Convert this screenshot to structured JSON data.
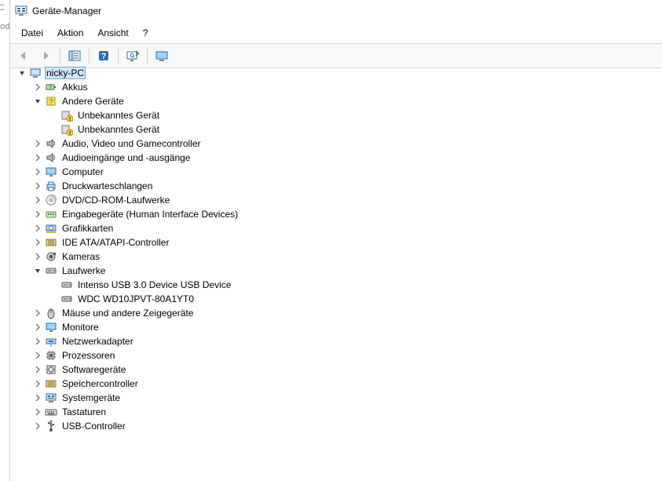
{
  "window": {
    "title": "Geräte-Manager"
  },
  "menubar": {
    "items": [
      "Datei",
      "Aktion",
      "Ansicht",
      "?"
    ]
  },
  "toolbar": {
    "back_enabled": false,
    "forward_enabled": false
  },
  "tree": {
    "root": {
      "label": "nicky-PC",
      "icon": "computer-icon",
      "expanded": true,
      "selected": true
    },
    "categories": [
      {
        "label": "Akkus",
        "icon": "battery-icon",
        "expandable": true,
        "expanded": false
      },
      {
        "label": "Andere Geräte",
        "icon": "other-devices-icon",
        "expandable": true,
        "expanded": true,
        "children": [
          {
            "label": "Unbekanntes Gerät",
            "icon": "unknown-device-icon"
          },
          {
            "label": "Unbekanntes Gerät",
            "icon": "unknown-device-icon"
          }
        ]
      },
      {
        "label": "Audio, Video und Gamecontroller",
        "icon": "audio-icon",
        "expandable": true,
        "expanded": false
      },
      {
        "label": "Audioeingänge und -ausgänge",
        "icon": "audio-io-icon",
        "expandable": true,
        "expanded": false
      },
      {
        "label": "Computer",
        "icon": "monitor-icon",
        "expandable": true,
        "expanded": false
      },
      {
        "label": "Druckwarteschlangen",
        "icon": "printer-icon",
        "expandable": true,
        "expanded": false
      },
      {
        "label": "DVD/CD-ROM-Laufwerke",
        "icon": "disc-icon",
        "expandable": true,
        "expanded": false
      },
      {
        "label": "Eingabegeräte (Human Interface Devices)",
        "icon": "hid-icon",
        "expandable": true,
        "expanded": false
      },
      {
        "label": "Grafikkarten",
        "icon": "gpu-icon",
        "expandable": true,
        "expanded": false
      },
      {
        "label": "IDE ATA/ATAPI-Controller",
        "icon": "ide-icon",
        "expandable": true,
        "expanded": false
      },
      {
        "label": "Kameras",
        "icon": "camera-icon",
        "expandable": true,
        "expanded": false
      },
      {
        "label": "Laufwerke",
        "icon": "drive-icon",
        "expandable": true,
        "expanded": true,
        "children": [
          {
            "label": "Intenso USB 3.0 Device USB Device",
            "icon": "drive-icon"
          },
          {
            "label": "WDC WD10JPVT-80A1YT0",
            "icon": "drive-icon"
          }
        ]
      },
      {
        "label": "Mäuse und andere Zeigegeräte",
        "icon": "mouse-icon",
        "expandable": true,
        "expanded": false
      },
      {
        "label": "Monitore",
        "icon": "monitor-icon",
        "expandable": true,
        "expanded": false
      },
      {
        "label": "Netzwerkadapter",
        "icon": "network-icon",
        "expandable": true,
        "expanded": false
      },
      {
        "label": "Prozessoren",
        "icon": "cpu-icon",
        "expandable": true,
        "expanded": false
      },
      {
        "label": "Softwaregeräte",
        "icon": "software-icon",
        "expandable": true,
        "expanded": false
      },
      {
        "label": "Speichercontroller",
        "icon": "storage-ctrl-icon",
        "expandable": true,
        "expanded": false
      },
      {
        "label": "Systemgeräte",
        "icon": "system-icon",
        "expandable": true,
        "expanded": false
      },
      {
        "label": "Tastaturen",
        "icon": "keyboard-icon",
        "expandable": true,
        "expanded": false
      },
      {
        "label": "USB-Controller",
        "icon": "usb-icon",
        "expandable": true,
        "expanded": false
      }
    ]
  },
  "outside_text": "ood"
}
